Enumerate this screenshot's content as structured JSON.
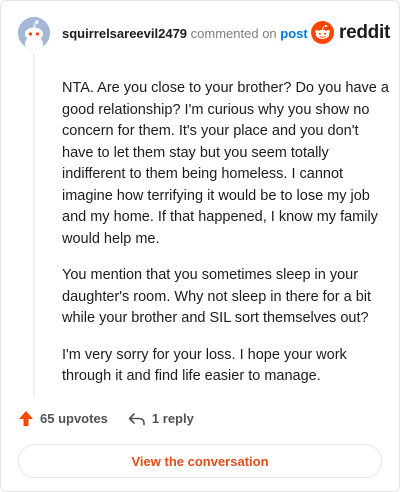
{
  "header": {
    "username": "squirrelsareevil2479",
    "commented_text": "commented on",
    "post_link": "post",
    "brand": "reddit"
  },
  "comment": {
    "paragraphs": [
      "NTA. Are you close to your brother? Do you have a good relationship? I'm curious why you show no concern for them. It's your place and you don't have to let them stay but you seem totally indifferent to them being homeless. I cannot imagine how terrifying it would be to lose my job and my home. If that happened, I know my family would help me.",
      "You mention that you sometimes sleep in your daughter's room. Why not sleep in there for a bit while your brother and SIL sort themselves out?",
      "I'm very sorry for your loss. I hope your work through it and find life easier to manage."
    ]
  },
  "actions": {
    "upvotes_label": "65 upvotes",
    "reply_label": "1 reply",
    "view_button": "View the conversation"
  },
  "icons": {
    "upvote": "upvote-arrow-icon",
    "reply": "reply-arrow-icon",
    "avatar": "snoo-avatar",
    "logo": "reddit-snoo-logo"
  },
  "colors": {
    "accent": "#ff4500",
    "link": "#0079d3",
    "button_text": "#e04c1c",
    "avatar_bg": "#a6b8d8"
  }
}
